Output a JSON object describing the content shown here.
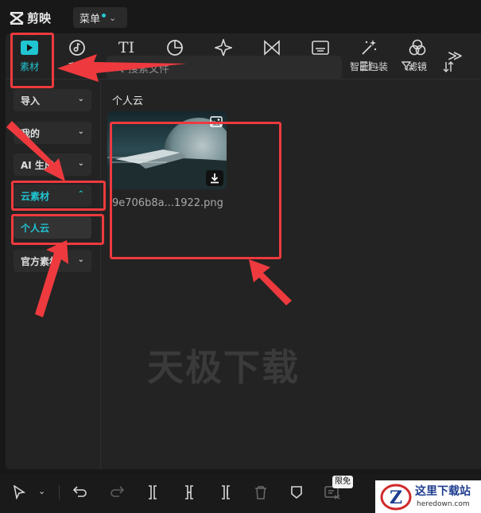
{
  "app": {
    "name": "剪映",
    "menu_label": "菜单"
  },
  "toolbar": {
    "tabs": [
      {
        "id": "media",
        "label": "素材",
        "icon": "play-square-icon",
        "active": true
      },
      {
        "id": "audio",
        "label": "音频",
        "icon": "music-note-icon",
        "active": false
      },
      {
        "id": "text",
        "label": "文本",
        "icon": "text-ti-icon",
        "active": false
      },
      {
        "id": "stickers",
        "label": "贴纸",
        "icon": "sticker-icon",
        "active": false
      },
      {
        "id": "effects",
        "label": "特效",
        "icon": "sparkle-star-icon",
        "active": false
      },
      {
        "id": "transitions",
        "label": "转场",
        "icon": "transition-bowtie-icon",
        "active": false
      },
      {
        "id": "captions",
        "label": "字幕",
        "icon": "caption-box-icon",
        "active": false
      },
      {
        "id": "smart_pack",
        "label": "智能包装",
        "icon": "magic-wand-icon",
        "active": false
      },
      {
        "id": "filters",
        "label": "滤镜",
        "icon": "filter-circles-icon",
        "active": false
      }
    ],
    "more_label": "≫"
  },
  "sidebar": {
    "items": [
      {
        "label": "导入",
        "expanded": false
      },
      {
        "label": "我的",
        "expanded": false
      },
      {
        "label": "AI 生成",
        "expanded": false
      },
      {
        "label": "云素材",
        "expanded": true
      },
      {
        "label": "个人云",
        "sub": true
      },
      {
        "label": "官方素材",
        "expanded": false
      }
    ]
  },
  "search": {
    "placeholder": "搜索文件"
  },
  "content": {
    "section_title": "个人云",
    "files": [
      {
        "name": "9e706b8a...1922.png",
        "type": "image"
      }
    ]
  },
  "watermark": "天极下载",
  "bottom": {
    "badge": "限免"
  },
  "brand": {
    "title": "这里下载站",
    "url": "heredown.com",
    "logo_letter": "Z"
  },
  "colors": {
    "accent": "#20c5d2",
    "annotation": "#ee3a3e",
    "panel": "#232323"
  }
}
